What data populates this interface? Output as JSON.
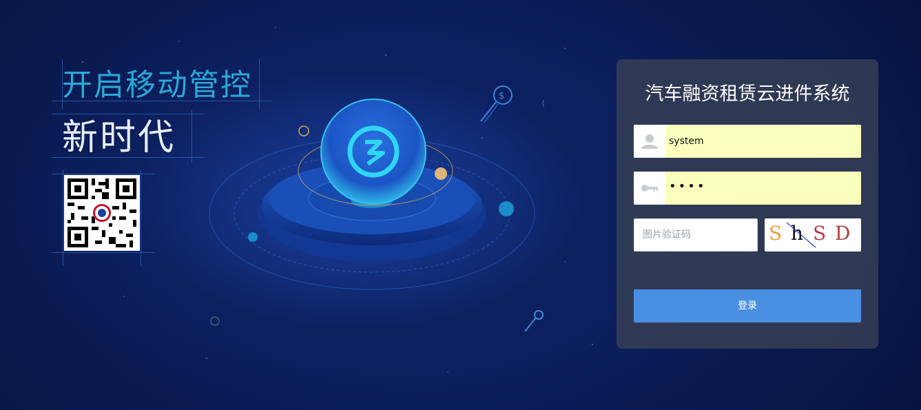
{
  "slogan": {
    "line1": "开启移动管控",
    "line2": "新时代"
  },
  "qr_code": {
    "icon": "qr-code-icon"
  },
  "login": {
    "title": "汽车融资租赁云进件系统",
    "username_value": "system",
    "username_icon": "user-icon",
    "password_value": "••••",
    "password_icon": "key-icon",
    "captcha_placeholder": "图片验证码",
    "captcha_text": "ShSD",
    "login_button": "登录"
  },
  "colors": {
    "accent": "#4a90e2",
    "autofill": "#faffbd",
    "slogan_blue": "#2aa8d8",
    "panel": "#343e54"
  }
}
